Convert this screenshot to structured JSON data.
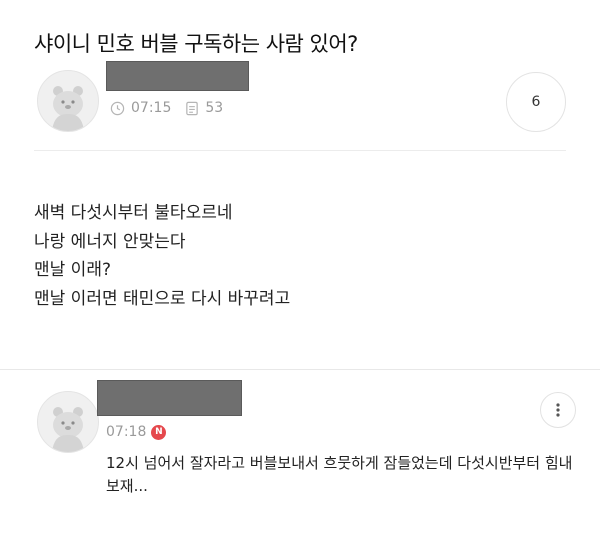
{
  "post": {
    "title": "샤이니 민호 버블 구독하는 사람 있어?",
    "time": "07:15",
    "views": "53",
    "comment_count": "6",
    "body_lines": [
      "새벽 다섯시부터 불타오르네",
      "나랑 에너지 안맞는다",
      "맨날 이래?",
      "맨날 이러면 태민으로 다시 바꾸려고"
    ]
  },
  "comment": {
    "time": "07:18",
    "new_badge": "N",
    "text": "12시 넘어서 잘자라고 버블보내서 흐뭇하게 잠들었는데 다섯시반부터 힘내보재..."
  },
  "icons": {
    "time": "clock-icon",
    "views": "document-icon",
    "more": "more-vertical-icon",
    "avatar": "default-avatar-icon"
  },
  "colors": {
    "new_badge": "#e5484d",
    "meta_text": "#9a9a9a",
    "redaction": "#6f6f6f"
  }
}
